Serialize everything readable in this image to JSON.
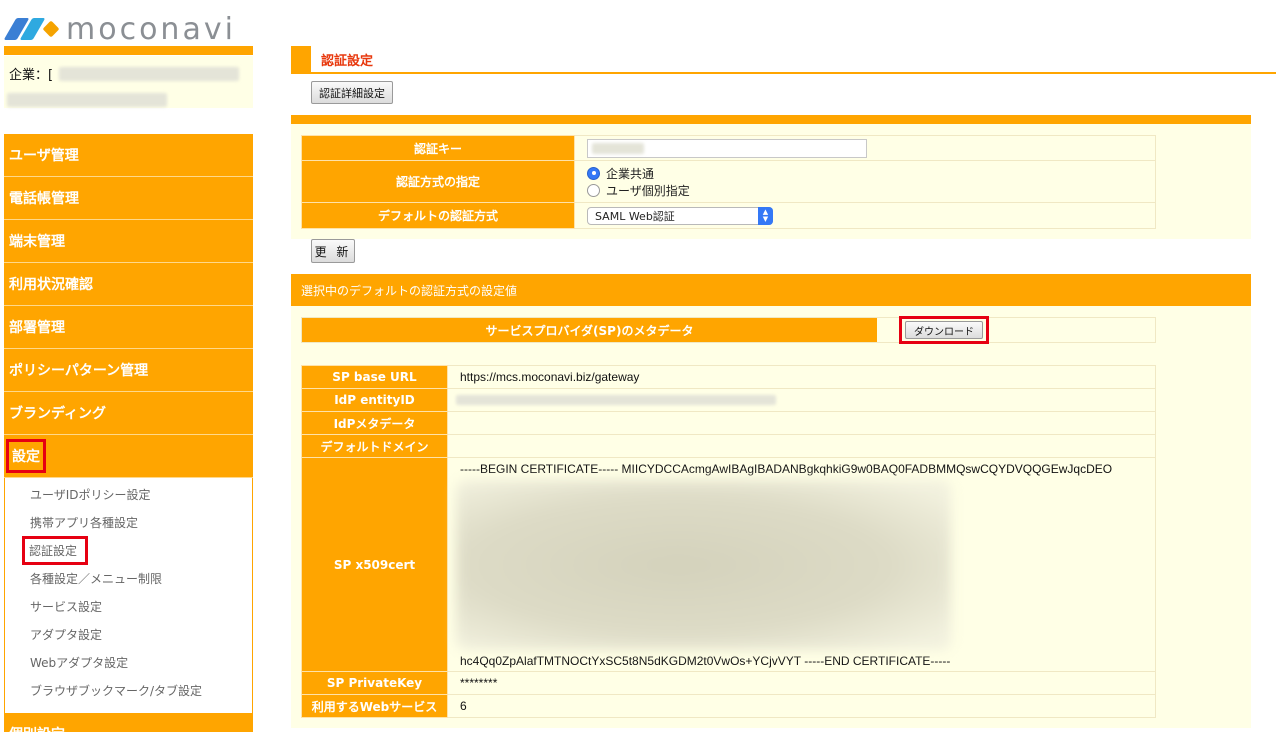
{
  "brand": {
    "logo_text": "moconavi"
  },
  "company": {
    "label": "企業：["
  },
  "sidebar": {
    "items": [
      {
        "label": "ユーザ管理"
      },
      {
        "label": "電話帳管理"
      },
      {
        "label": "端末管理"
      },
      {
        "label": "利用状況確認"
      },
      {
        "label": "部署管理"
      },
      {
        "label": "ポリシーパターン管理"
      },
      {
        "label": "ブランディング"
      },
      {
        "label": "設定"
      }
    ],
    "sub_items": [
      {
        "label": "ユーザIDポリシー設定"
      },
      {
        "label": "携帯アプリ各種設定"
      },
      {
        "label": "認証設定"
      },
      {
        "label": "各種設定／メニュー制限"
      },
      {
        "label": "サービス設定"
      },
      {
        "label": "アダプタ設定"
      },
      {
        "label": "Webアダプタ設定"
      },
      {
        "label": "ブラウザブックマーク/タブ設定"
      }
    ],
    "next_item": {
      "label": "個別設定"
    }
  },
  "page": {
    "title": "認証設定",
    "detail_button": "認証詳細設定"
  },
  "auth_form": {
    "key_label": "認証キー",
    "method_label": "認証方式の指定",
    "radio_options": [
      {
        "label": "企業共通",
        "checked": true
      },
      {
        "label": "ユーザ個別指定",
        "checked": false
      }
    ],
    "default_label": "デフォルトの認証方式",
    "default_value": "SAML Web認証",
    "update_button": "更 新"
  },
  "sp_section": {
    "heading": "選択中のデフォルトの認証方式の設定値",
    "metadata_label": "サービスプロバイダ(SP)のメタデータ",
    "download_button": "ダウンロード",
    "rows": {
      "base_url_label": "SP base URL",
      "base_url_value": "https://mcs.moconavi.biz/gateway",
      "idp_entity_label": "IdP entityID",
      "idp_meta_label": "IdPメタデータ",
      "default_domain_label": "デフォルトドメイン",
      "cert_label": "SP x509cert",
      "cert_first_line": "-----BEGIN CERTIFICATE----- MIICYDCCAcmgAwIBAgIBADANBgkqhkiG9w0BAQ0FADBMMQswCQYDVQQGEwJqcDEO",
      "cert_last_line": "hc4Qq0ZpAlafTMTNOCtYxSC5t8N5dKGDM2t0VwOs+YCjvVYT -----END CERTIFICATE-----",
      "private_key_label": "SP PrivateKey",
      "private_key_value": "********",
      "web_service_label": "利用するWebサービス",
      "web_service_value": "6"
    }
  },
  "colors": {
    "accent": "#ffa500",
    "panel": "#ffffe6",
    "title_red": "#e8380d",
    "highlight": "#e60012"
  }
}
